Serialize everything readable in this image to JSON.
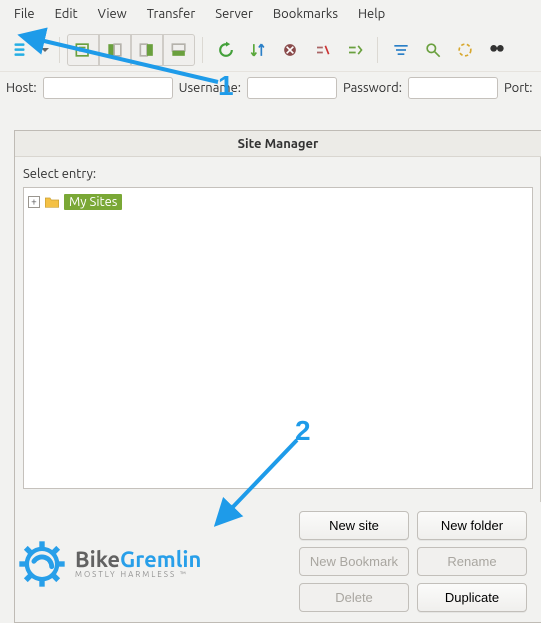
{
  "menu": {
    "file": "File",
    "edit": "Edit",
    "view": "View",
    "transfer": "Transfer",
    "server": "Server",
    "bookmarks": "Bookmarks",
    "help": "Help"
  },
  "quickconnect": {
    "host_label": "Host:",
    "host_value": "",
    "username_label": "Username:",
    "username_value": "",
    "password_label": "Password:",
    "password_value": "",
    "port_label": "Port:"
  },
  "dialog": {
    "title": "Site Manager",
    "select_entry_label": "Select entry:",
    "root_node": "My Sites",
    "buttons": {
      "new_site": "New site",
      "new_folder": "New folder",
      "new_bookmark": "New Bookmark",
      "rename": "Rename",
      "delete": "Delete",
      "duplicate": "Duplicate"
    }
  },
  "annotations": {
    "one": "1",
    "two": "2"
  },
  "watermark": {
    "brand_a": "Bike",
    "brand_b": "Gremlin",
    "tagline": "MOSTLY HARMLESS ™"
  },
  "colors": {
    "accent": "#1e9be9",
    "selection": "#7aa836"
  }
}
